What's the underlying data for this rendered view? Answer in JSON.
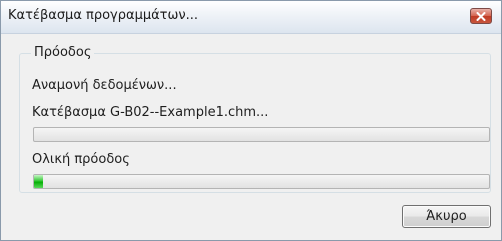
{
  "window": {
    "title": "Κατέβασμα προγραμμάτων..."
  },
  "group": {
    "legend": "Πρόοδος",
    "status_text": "Αναμονή δεδομένων...",
    "current_file_text": "Κατέβασμα G-B02--Example1.chm...",
    "file_progress": 0,
    "overall_label": "Ολική πρόοδος",
    "overall_progress": 0.02
  },
  "buttons": {
    "cancel_label": "Άκυρο"
  },
  "colors": {
    "progress_fill": "#06b006",
    "close_button": "#c8563e"
  },
  "icons": {
    "close": "close-icon"
  }
}
